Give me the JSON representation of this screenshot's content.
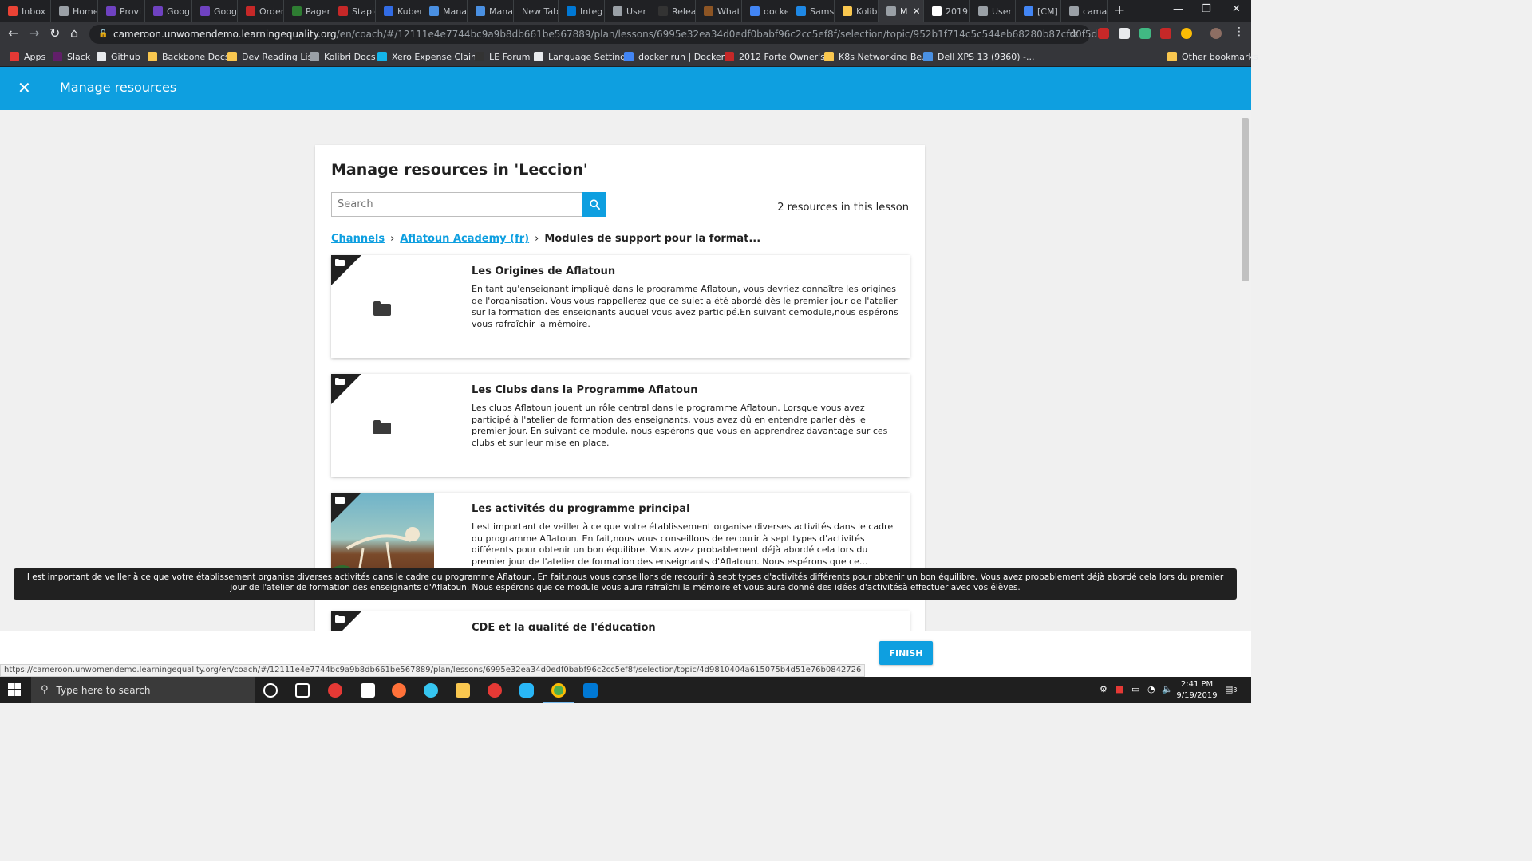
{
  "browser": {
    "tabs": [
      {
        "label": "Inbox",
        "color": "#ea4335"
      },
      {
        "label": "Home",
        "color": "#9aa0a6"
      },
      {
        "label": "Provi",
        "color": "#6f42c1"
      },
      {
        "label": "Goog",
        "color": "#6f42c1"
      },
      {
        "label": "Goog",
        "color": "#6f42c1"
      },
      {
        "label": "Order",
        "color": "#c62828"
      },
      {
        "label": "Pager",
        "color": "#2e7d32"
      },
      {
        "label": "Staple",
        "color": "#c62828"
      },
      {
        "label": "Kuber",
        "color": "#326ce5"
      },
      {
        "label": "Mana",
        "color": "#4a90e2"
      },
      {
        "label": "Mana",
        "color": "#4a90e2"
      },
      {
        "label": "New Tab",
        "color": ""
      },
      {
        "label": "Integ",
        "color": "#0078d4"
      },
      {
        "label": "User (",
        "color": "#9aa0a6"
      },
      {
        "label": "Relea",
        "color": "#333333"
      },
      {
        "label": "What",
        "color": "#8d5524"
      },
      {
        "label": "docke",
        "color": "#4285f4"
      },
      {
        "label": "Sams",
        "color": "#1e88e5"
      },
      {
        "label": "Kolibr",
        "color": "#f9c74f"
      },
      {
        "label": "M",
        "color": "#9aa0a6"
      },
      {
        "label": "2019",
        "color": "#ffffff"
      },
      {
        "label": "User S",
        "color": "#9aa0a6"
      },
      {
        "label": "[CM]",
        "color": "#4285f4"
      },
      {
        "label": "cama",
        "color": "#9aa0a6"
      }
    ],
    "active_tab_index": 19,
    "url_host": "cameroon.unwomendemo.learningequality.org",
    "url_path": "/en/coach/#/12111e4e7744bc9a9b8db661be567889/plan/lessons/6995e32ea34d0edf0babf96c2cc5ef8f/selection/topic/952b1f714c5c544eb68280b87cfd0f5d",
    "bookmarks": [
      {
        "label": "Apps",
        "color": "#e53935"
      },
      {
        "label": "Slack",
        "color": "#611f69"
      },
      {
        "label": "Github",
        "color": "#e8eaed"
      },
      {
        "label": "Backbone Docs",
        "color": "#f9c74f"
      },
      {
        "label": "Dev Reading List",
        "color": "#f9c74f"
      },
      {
        "label": "Kolibri Docs",
        "color": "#9aa0a6"
      },
      {
        "label": "Xero Expense Claims",
        "color": "#13b5ea"
      },
      {
        "label": "LE Forum",
        "color": "#333333"
      },
      {
        "label": "Language Settings",
        "color": "#e8eaed"
      },
      {
        "label": "docker run | Docker...",
        "color": "#4285f4"
      },
      {
        "label": "2012 Forte Owner's...",
        "color": "#c62828"
      },
      {
        "label": "K8s Networking Be...",
        "color": "#f9c74f"
      },
      {
        "label": "Dell XPS 13 (9360) -...",
        "color": "#4a90e2"
      },
      {
        "label": "Other bookmarks",
        "color": "#f9c74f"
      }
    ]
  },
  "app": {
    "header_title": "Manage resources",
    "card_title": "Manage resources in 'Leccion'",
    "search_placeholder": "Search",
    "resource_count": "2 resources in this lesson",
    "breadcrumb": {
      "channels": "Channels",
      "channel": "Aflatoun Academy (fr)",
      "separator": "›",
      "current": "Modules de support pour la format..."
    },
    "resources": [
      {
        "title": "Les Origines de Aflatoun",
        "description": "En tant qu'enseignant impliqué dans le programme Aflatoun, vous devriez connaître les origines de l'organisation. Vous vous rappellerez que ce sujet a été abordé dès le premier jour de l'atelier sur la formation des enseignants auquel vous avez participé.En suivant cemodule,nous espérons vous rafraîchir la mémoire.",
        "thumbnail": "folder"
      },
      {
        "title": "Les Clubs dans la Programme Aflatoun",
        "description": "Les clubs Aflatoun jouent un rôle central dans le programme Aflatoun. Lorsque vous avez participé à l'atelier de formation des enseignants, vous avez dû en entendre parler dès le premier jour. En suivant ce module, nous espérons que vous en apprendrez davantage sur ces clubs et sur leur mise en place.",
        "thumbnail": "folder"
      },
      {
        "title": "Les activités du programme principal",
        "description": "I est important de veiller à ce que votre établissement organise diverses activités dans le cadre du programme Aflatoun. En fait,nous vous conseillons de recourir à sept types d'activités différents pour obtenir un bon équilibre. Vous avez probablement déjà abordé cela lors du premier jour de l'atelier de formation des enseignants d'Aflatoun. Nous espérons que ce...",
        "thumbnail": "image"
      },
      {
        "title": "CDE et la qualité de l'éducation",
        "description": "",
        "thumbnail": "folder"
      }
    ],
    "tooltip": "I est important de veiller à ce que votre établissement organise diverses activités dans le cadre du programme Aflatoun. En fait,nous vous conseillons de recourir à sept types d'activités différents pour obtenir un bon équilibre. Vous avez probablement déjà abordé cela lors du premier jour de l'atelier de formation des enseignants d'Aflatoun. Nous espérons que ce module vous aura rafraîchi la mémoire et vous aura donné des idées d'activitésà effectuer avec vos élèves.",
    "finish_label": "FINISH",
    "status_url": "https://cameroon.unwomendemo.learningequality.org/en/coach/#/12111e4e7744bc9a9b8db661be567889/plan/lessons/6995e32ea34d0edf0babf96c2cc5ef8f/selection/topic/4d9810404a615075b4d51e76b0842726",
    "accent_color": "#0e9fe0"
  },
  "taskbar": {
    "search_placeholder": "Type here to search",
    "time": "2:41 PM",
    "date": "9/19/2019",
    "notification_count": "3"
  }
}
